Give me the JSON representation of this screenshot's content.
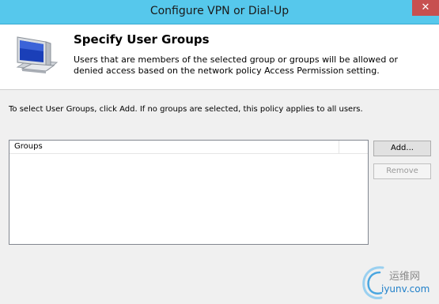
{
  "window": {
    "title": "Configure VPN or Dial-Up",
    "close_glyph": "✕"
  },
  "header": {
    "icon": "monitor-icon",
    "title": "Specify User Groups",
    "description": "Users that are members of the selected group or groups will be allowed or denied access based on the network policy Access Permission setting."
  },
  "instruction": "To select User Groups, click Add. If no groups are selected, this policy applies to all users.",
  "groups": {
    "column_header": "Groups",
    "items": []
  },
  "buttons": {
    "add_label": "Add...",
    "remove_label": "Remove"
  },
  "watermark": {
    "chinese_text": "运维网",
    "url": "iyunv.com"
  },
  "colors": {
    "titlebar": "#56c8ec",
    "close_button": "#c75050",
    "watermark_blue": "#1f7fc9"
  }
}
